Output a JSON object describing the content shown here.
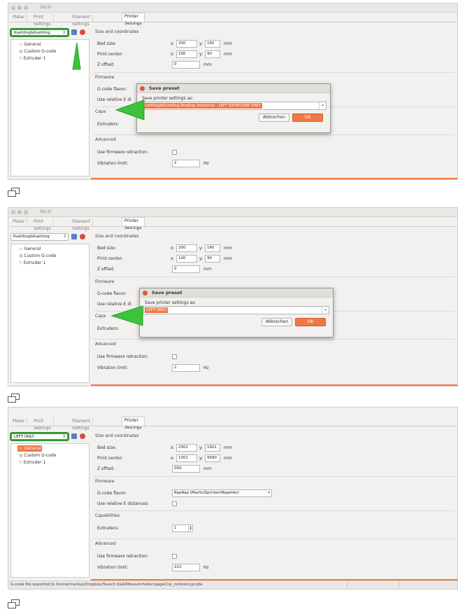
{
  "window": {
    "title": "Slic3r"
  },
  "tabs": [
    "Plater",
    "Print Settings",
    "Filament Settings",
    "Printer Settings"
  ],
  "tree": {
    "items": [
      "General",
      "Custom G-code",
      "Extruder 1"
    ]
  },
  "sections": {
    "size": "Size and coordinates",
    "firmware": "Firmware",
    "capabilities": "Capabilities",
    "advanced": "Advanced"
  },
  "labels": {
    "bed_size": "Bed size:",
    "print_center": "Print center:",
    "z_offset": "Z offset:",
    "gcode_flavor": "G-code flavor:",
    "relative_e": "Use relative E distances:",
    "extruders": "Extruders:",
    "fw_retraction": "Use firmware retraction:",
    "vibration": "Vibration limit:",
    "x": "x:",
    "y": "y:",
    "mm": "mm",
    "hz": "Hz"
  },
  "truncated": {
    "gcode_flavor": "G-code flavor:",
    "relative_e": "Use relative E di",
    "capabilities": "Capa"
  },
  "dialog": {
    "title": "Save preset",
    "prompt": "Save printer settings as:",
    "cancel": "Abbrechen",
    "ok": "OK"
  },
  "shot1": {
    "preset": "Kuehling&Kuehling",
    "bed_x": "200",
    "bed_y": "160",
    "center_x": "100",
    "center_y": "90",
    "z_offset": "0",
    "vibration": "2",
    "dialog_value": "Kuehling&Kuehling RepRap Industrial - LEFT EXTRUDER ONLY"
  },
  "shot2": {
    "preset": "Kuehling&Kuehling",
    "bed_x": "200",
    "bed_y": "160",
    "center_x": "100",
    "center_y": "90",
    "z_offset": "0",
    "vibration": "2",
    "dialog_value": "LEFT ONLY"
  },
  "shot3": {
    "preset": "LEFT ONLY",
    "bed_x": "2002",
    "bed_y": "1601",
    "center_x": "1001",
    "center_y": "9090",
    "z_offset": "000",
    "gcode_flavor": "RepRap (Marlin/Sprinter/Repetier)",
    "extruders": "1",
    "vibration": "222",
    "status": "G-code file exported to /home/markus/Dropbox/Tausch K&K/Messuhrhalter/gageClip_romboid.gcode"
  },
  "colors": {
    "accent": "#f07846",
    "highlight": "#35a635"
  },
  "icons": [
    "window-close-icon",
    "window-minimize-icon",
    "window-maximize-icon",
    "save-preset-icon",
    "delete-preset-icon",
    "general-icon",
    "gcode-icon",
    "extruder-icon",
    "restore-window-icon"
  ]
}
